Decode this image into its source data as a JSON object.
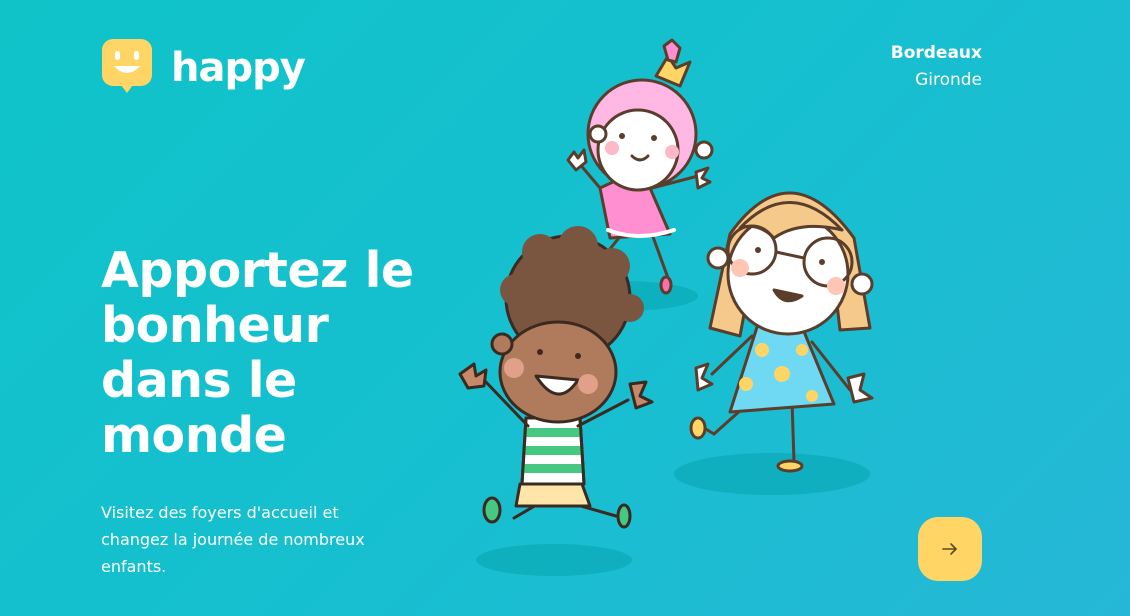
{
  "brand": {
    "name": "happy",
    "icon": "smiley-chat-icon",
    "icon_color": "#ffd666"
  },
  "location": {
    "city": "Bordeaux",
    "region": "Gironde"
  },
  "hero": {
    "title": "Apportez le bonheur dans le monde",
    "description": "Visitez des foyers d'accueil et changez la journée de nombreux enfants."
  },
  "navigation": {
    "next_icon": "arrow-right-icon"
  },
  "theme": {
    "background_start": "#0fc3c9",
    "background_end": "#26b7d7",
    "accent": "#ffd666",
    "text": "#ffffff"
  }
}
